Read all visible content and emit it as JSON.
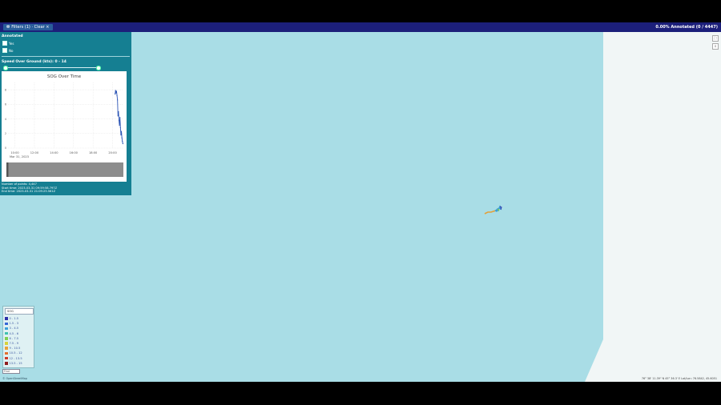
{
  "topbar": {
    "filters_label": "Filters (1) · Clear ×",
    "annotated_status": "0.00% Annotated (0 / 4447)"
  },
  "panel": {
    "annotated_title": "Annotated",
    "yes_label": "Yes",
    "no_label": "No",
    "sog_title": "Speed Over Ground (kts): 0 - 14",
    "slider": {
      "low_fraction": 0.0,
      "high_fraction": 1.0
    }
  },
  "chart_data": {
    "type": "line",
    "title": "SOG Over Time",
    "x_ticks": [
      "10:00",
      "12:00",
      "14:00",
      "16:00",
      "18:00",
      "20:00"
    ],
    "date_label": "Mar 31, 2023",
    "y_ticks": [
      "0",
      "2",
      "4",
      "6",
      "8"
    ],
    "ylim": [
      0,
      9
    ],
    "x_hours": [
      20.25,
      20.3,
      20.35,
      20.4,
      20.45,
      20.5,
      20.55,
      20.6,
      20.65,
      20.7,
      20.75,
      20.8,
      20.85,
      20.9,
      20.95,
      21.0,
      21.05
    ],
    "values": [
      7.4,
      7.9,
      7.6,
      7.8,
      7.2,
      6.6,
      4.4,
      5.0,
      3.8,
      3.1,
      4.2,
      2.8,
      1.8,
      2.3,
      1.4,
      0.9,
      0.6
    ],
    "x_range": [
      9.3,
      21.1
    ],
    "grid": true
  },
  "stats": {
    "points": "Number of points: 4,447",
    "start": "Start time: 2023-03-31 09:59:58.797Z",
    "end": "End time: 2023-03-31 21:09:25.561Z"
  },
  "legend": {
    "title": "SOG",
    "items": [
      {
        "label": "0 - 1.5",
        "color": "#2b2fa8"
      },
      {
        "label": "1.5 - 3",
        "color": "#3566d6"
      },
      {
        "label": "3 - 4.5",
        "color": "#3b9fd8"
      },
      {
        "label": "4.5 - 6",
        "color": "#3fc1b0"
      },
      {
        "label": "6 - 7.5",
        "color": "#7fcf53"
      },
      {
        "label": "7.5 - 9",
        "color": "#d7d23c"
      },
      {
        "label": "9 - 10.5",
        "color": "#e9a13a"
      },
      {
        "label": "10.5 - 12",
        "color": "#e3702e"
      },
      {
        "label": "12 - 13.5",
        "color": "#cc3a2a"
      },
      {
        "label": "13.5 - 15",
        "color": "#8f1e1e"
      }
    ]
  },
  "search_placeholder": "Find",
  "attribution": "© OpenStreetMap",
  "coordinates": "76° 38' 11.39\" N 45° 36.3' E  Lat/Lon: 76.5842, 45.6051",
  "colors": {
    "sea": "#a9dde6",
    "land": "#f1f6f6",
    "topbar": "#1c1f7a",
    "panel": "#157f92"
  }
}
